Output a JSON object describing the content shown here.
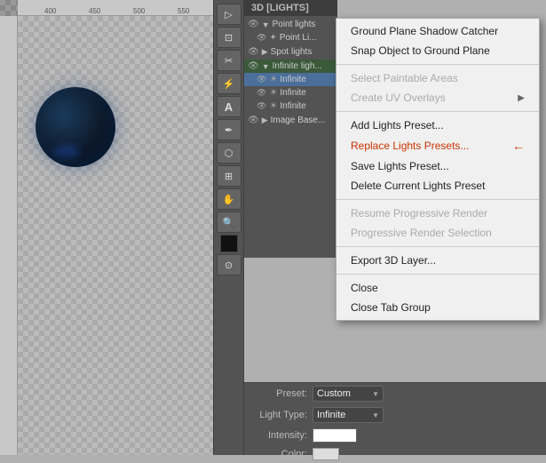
{
  "window": {
    "title": "3D [LIGHTS]"
  },
  "ruler": {
    "ticks": [
      "400",
      "450",
      "500",
      "550"
    ]
  },
  "lights_panel": {
    "title": "3D [LIGHTS]",
    "groups": [
      {
        "name": "Point lights",
        "items": [
          {
            "name": "Point Li...",
            "active": false
          }
        ]
      },
      {
        "name": "Spot lights",
        "items": []
      },
      {
        "name": "Infinite ligh...",
        "items": [
          {
            "name": "Infinite",
            "active": true
          },
          {
            "name": "Infinite",
            "active": false
          },
          {
            "name": "Infinite",
            "active": false
          }
        ]
      },
      {
        "name": "Image Base...",
        "items": []
      }
    ]
  },
  "context_menu": {
    "items": [
      {
        "label": "Ground Plane Shadow Catcher",
        "type": "normal",
        "id": "ground-plane-shadow"
      },
      {
        "label": "Snap Object to Ground Plane",
        "type": "normal",
        "id": "snap-object"
      },
      {
        "type": "separator"
      },
      {
        "label": "Select Paintable Areas",
        "type": "disabled",
        "id": "select-paintable"
      },
      {
        "label": "Create UV Overlays",
        "type": "disabled",
        "has_arrow": true,
        "id": "create-uv"
      },
      {
        "type": "separator"
      },
      {
        "label": "Add Lights Preset...",
        "type": "normal",
        "id": "add-lights-preset"
      },
      {
        "label": "Replace Lights Presets...",
        "type": "highlighted",
        "id": "replace-lights-presets"
      },
      {
        "label": "Save Lights Preset...",
        "type": "normal",
        "id": "save-lights-preset"
      },
      {
        "label": "Delete Current Lights Preset",
        "type": "normal",
        "id": "delete-lights-preset"
      },
      {
        "type": "separator"
      },
      {
        "label": "Resume Progressive Render",
        "type": "disabled",
        "id": "resume-render"
      },
      {
        "label": "Progressive Render Selection",
        "type": "disabled",
        "id": "progressive-render"
      },
      {
        "type": "separator"
      },
      {
        "label": "Export 3D Layer...",
        "type": "normal",
        "id": "export-3d"
      },
      {
        "type": "separator"
      },
      {
        "label": "Close",
        "type": "normal",
        "id": "close"
      },
      {
        "label": "Close Tab Group",
        "type": "normal",
        "id": "close-tab-group"
      }
    ]
  },
  "bottom_panel": {
    "preset_label": "Preset:",
    "preset_value": "Custom",
    "light_type_label": "Light Type:",
    "light_type_value": "Infinite",
    "intensity_label": "Intensity:",
    "color_label": "Color:"
  },
  "arrow": {
    "symbol": "→"
  }
}
